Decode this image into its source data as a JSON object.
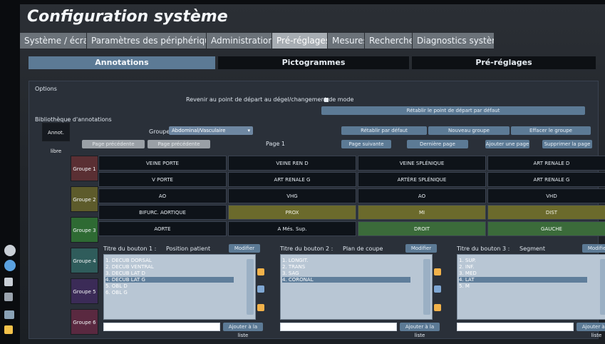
{
  "window": {
    "title": "Configuration système",
    "tabs": [
      {
        "label": "Système / écran",
        "active": false
      },
      {
        "label": "Paramètres des périphériques",
        "active": false
      },
      {
        "label": "Administration",
        "active": false
      },
      {
        "label": "Pré-réglages",
        "active": true
      },
      {
        "label": "Mesures",
        "active": false
      },
      {
        "label": "Recherche",
        "active": false
      },
      {
        "label": "Diagnostics système",
        "active": false
      }
    ],
    "subtabs": [
      {
        "label": "Annotations",
        "active": true
      },
      {
        "label": "Pictogrammes",
        "active": false
      },
      {
        "label": "Pré-réglages",
        "active": false
      }
    ]
  },
  "options": {
    "section_label": "Options",
    "reset_option_label": "Revenir au point de départ au dégel/changement de mode",
    "reset_default_button": "Rétablir le point de départ par défaut"
  },
  "library": {
    "section_label": "Bibliothèque d'annotations",
    "free_text_label": "Annot. libre",
    "group_label": "Groupe",
    "group_value": "Abdominal/Vasculaire",
    "buttons_top": [
      "Rétablir par défaut",
      "Nouveau groupe",
      "Effacer le groupe"
    ],
    "buttons_dim": [
      "Page précédente",
      "Page précédente"
    ],
    "page_label": "Page 1",
    "buttons_pages": [
      "Page suivante",
      "Dernière page",
      "Ajouter une page",
      "Supprimer la page"
    ],
    "groups": [
      {
        "label": "Groupe 1",
        "color": "#5a2f33"
      },
      {
        "label": "Groupe 2",
        "color": "#5d5b2b"
      },
      {
        "label": "Groupe 3",
        "color": "#2e6a33"
      },
      {
        "label": "Groupe 4",
        "color": "#2f5c5b"
      },
      {
        "label": "Groupe 5",
        "color": "#3b2b57"
      },
      {
        "label": "Groupe 6",
        "color": "#5a2940"
      }
    ],
    "grid_rows": [
      [
        {
          "text": "VEINE PORTE",
          "style": "dark"
        },
        {
          "text": "VEINE REN D",
          "style": "dark"
        },
        {
          "text": "VEINE SPLÉNIQUE",
          "style": "dark"
        },
        {
          "text": "ART RENALE D",
          "style": "dark"
        }
      ],
      [
        {
          "text": "V PORTE",
          "style": "dark"
        },
        {
          "text": "ART RENALE G",
          "style": "dark"
        },
        {
          "text": "ARTÈRE SPLÉNIQUE",
          "style": "dark"
        },
        {
          "text": "ART RENALE G",
          "style": "dark"
        }
      ],
      [
        {
          "text": "AO",
          "style": "dark"
        },
        {
          "text": "VHG",
          "style": "dark"
        },
        {
          "text": "AO",
          "style": "dark"
        },
        {
          "text": "VHD",
          "style": "dark"
        }
      ],
      [
        {
          "text": "BIFURC. AORTIQUE",
          "style": "dark"
        },
        {
          "text": "PROX",
          "style": "olive"
        },
        {
          "text": "MI",
          "style": "olive"
        },
        {
          "text": "DIST",
          "style": "olive"
        }
      ],
      [
        {
          "text": "AORTE",
          "style": "dark"
        },
        {
          "text": "A Més. Sup.",
          "style": "dark"
        },
        {
          "text": "DROIT",
          "style": "green"
        },
        {
          "text": "GAUCHE",
          "style": "green"
        }
      ]
    ],
    "panels": [
      {
        "title": "Titre du bouton 1 :",
        "subtitle": "Position patient",
        "edit_label": "Modifier titre",
        "items": [
          "1. DECUB DORSAL",
          "2. DECUB VENTRAL",
          "3. DECUB LAT D",
          "4. DECUB LAT G",
          "5. OBL D",
          "6. OBL G"
        ],
        "selected_index": 3,
        "add_label": "Ajouter à la liste"
      },
      {
        "title": "Titre du bouton 2 :",
        "subtitle": "Plan de coupe",
        "edit_label": "Modifier titre",
        "items": [
          "1. LONGIT.",
          "2. TRANS",
          "3. SAG",
          "4. CORONAL"
        ],
        "selected_index": 3,
        "add_label": "Ajouter à la liste"
      },
      {
        "title": "Titre du bouton 3 :",
        "subtitle": "Segment",
        "edit_label": "Modifier titre",
        "items": [
          "1. SUP.",
          "2. INF.",
          "3. MED",
          "4. LAT",
          "5. M"
        ],
        "selected_index": 3,
        "add_label": "Ajouter à la liste"
      }
    ]
  },
  "left_icons": [
    "settings-icon",
    "globe-icon",
    "doc-icon",
    "audio-icon",
    "image-icon",
    "brush-icon"
  ]
}
